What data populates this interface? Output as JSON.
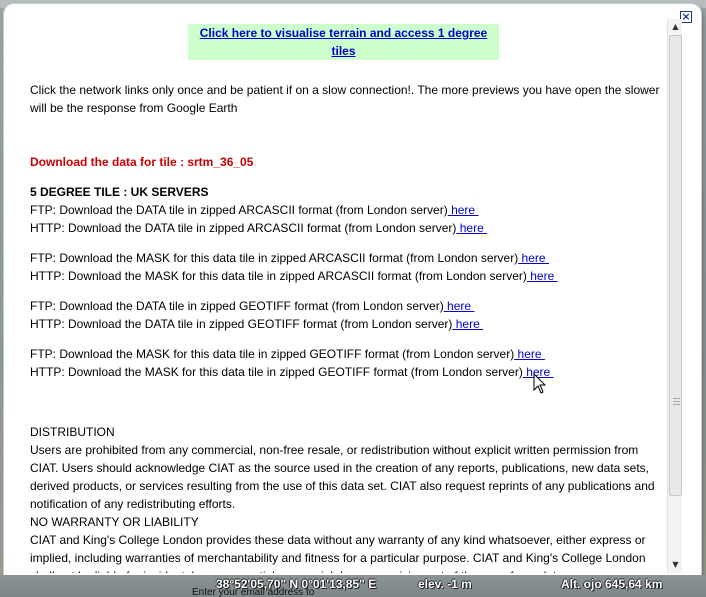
{
  "balloon": {
    "close_icon": "close-icon",
    "terrain_link": "Click here to visualise terrain and access 1 degree tiles",
    "intro_text": "Click the network links only once and be patient if on a slow connection!. The more previews you have open the slower will be the response from Google Earth",
    "download_heading": "Download the data for tile : srtm_36_05",
    "tile_heading": "5 DEGREE TILE : UK SERVERS",
    "link_label": "here",
    "downloads": [
      "FTP: Download the DATA tile in zipped ARCASCII format (from London server)",
      "HTTP: Download the DATA tile in zipped ARCASCII format (from London server)",
      "FTP: Download the MASK for this data tile in zipped ARCASCII format (from London server)",
      "HTTP: Download the MASK for this data tile in zipped ARCASCII format (from London server)",
      "FTP: Download the DATA tile in zipped GEOTIFF format (from London server)",
      "HTTP: Download the DATA tile in zipped GEOTIFF format (from London server)",
      "FTP: Download the MASK for this data tile in zipped GEOTIFF format (from London server)",
      "HTTP: Download the MASK for this data tile in zipped GEOTIFF format (from London server)"
    ],
    "distribution_heading": "DISTRIBUTION",
    "distribution_text": "Users are prohibited from any commercial, non-free resale, or redistribution without explicit written permission from CIAT. Users should acknowledge CIAT as the source used in the creation of any reports, publications, new data sets, derived products, or services resulting from the use of this data set. CIAT also request reprints of any publications and notification of any redistributing efforts.",
    "warranty_heading": "NO WARRANTY OR LIABILITY",
    "warranty_text": "CIAT and King's College London provides these data without any warranty of any kind whatsoever, either express or implied, including warranties of merchantability and fitness for a particular purpose. CIAT and King's College London shall not be liable for incidental, consequential, or special damages arising out of the use of any data."
  },
  "status_bar": {
    "coordinates": "38°52'05,70\" N   0°01'13,85\" E",
    "elevation": "elev.   -1 m",
    "altitude": "Alt. ojo   645,64 km",
    "partial_text": "Enter your email address to"
  },
  "colors": {
    "link": "#0000cc",
    "heading_red": "#cc0000",
    "green_box": "#ccffcc"
  }
}
